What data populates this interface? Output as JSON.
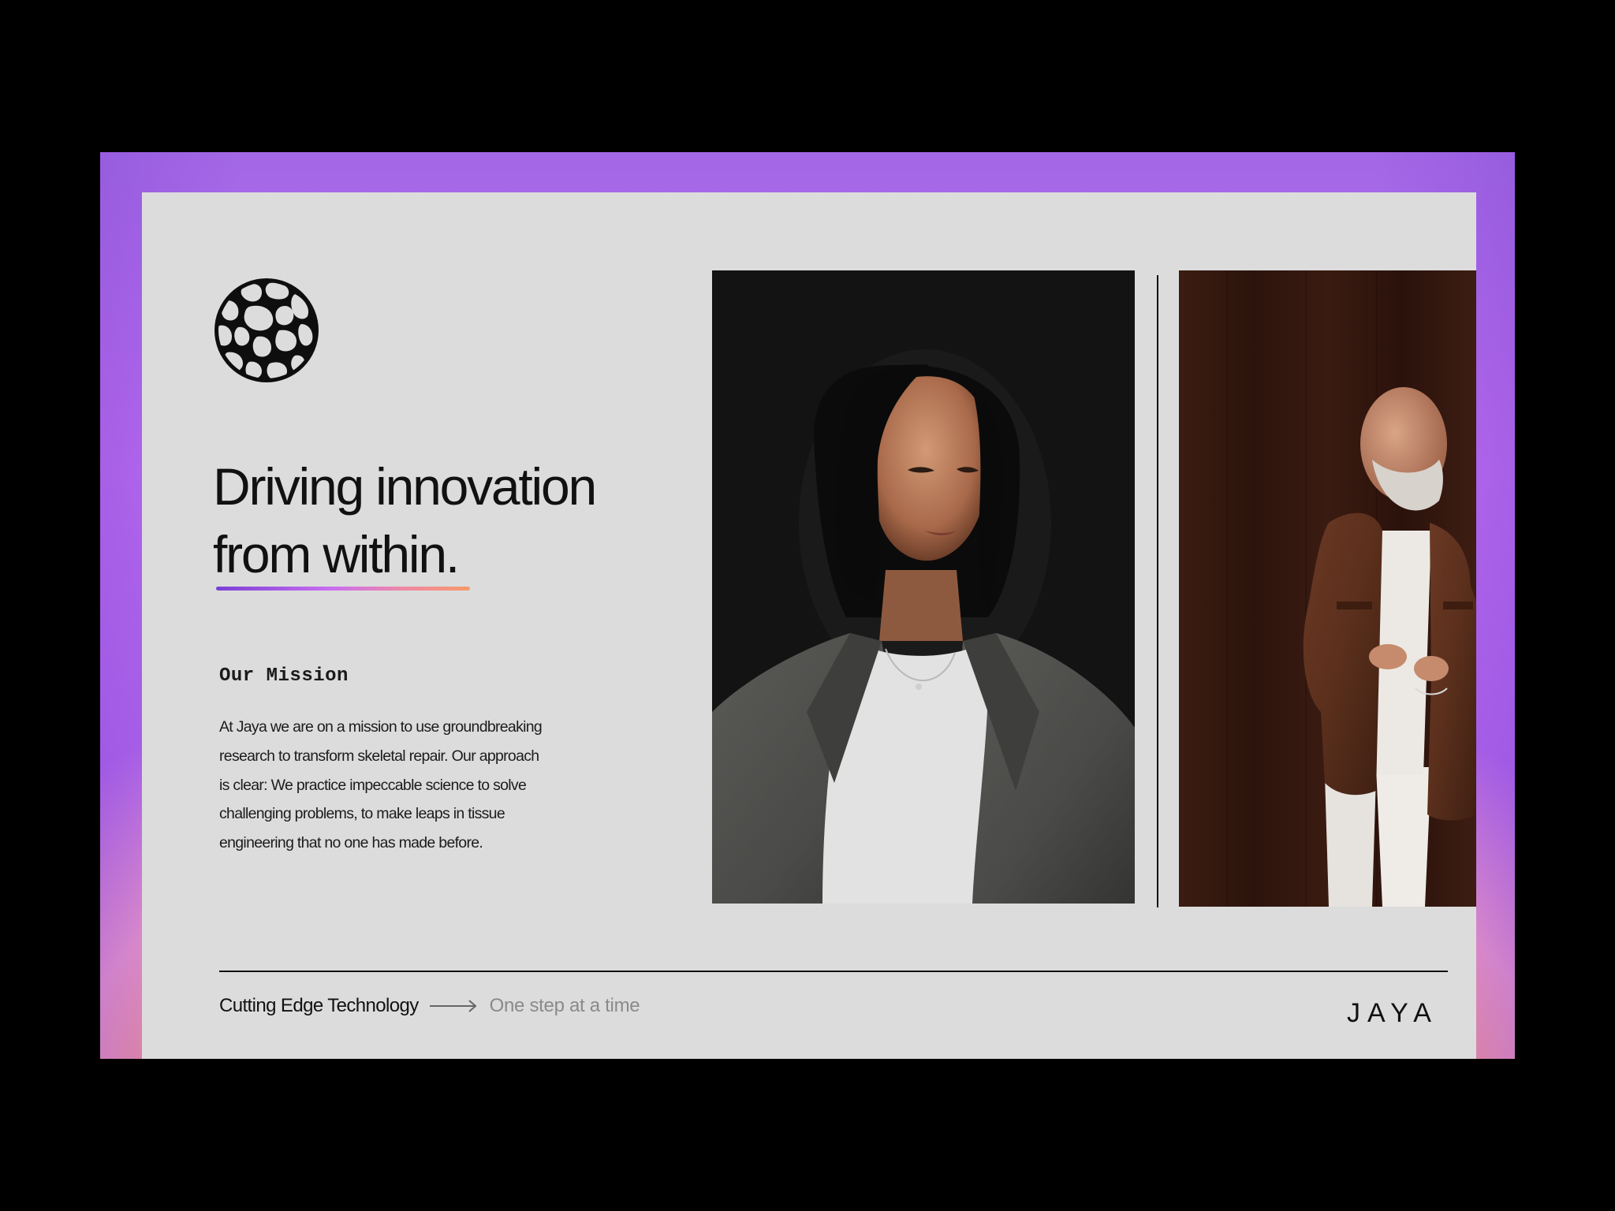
{
  "slide": {
    "headline": {
      "line1": "Driving innovation",
      "line2": "from within."
    },
    "mission": {
      "title": "Our Mission",
      "lines": [
        "At Jaya we are on a mission to use groundbreaking",
        "research to transform skeletal repair. Our approach",
        "is clear: We practice impeccable science to solve",
        "challenging problems, to make leaps in tissue",
        "engineering that no one has made before."
      ]
    },
    "footer": {
      "primary": "Cutting Edge Technology",
      "secondary": "One step at a time",
      "brand": "JAYA"
    },
    "icons": {
      "logo": "cellular-sphere-logo-icon",
      "arrow": "arrow-right-icon"
    },
    "photos": {
      "left": "portrait-woman-photo",
      "right": "portrait-man-photo"
    }
  },
  "colors": {
    "page_background": "#000000",
    "card_background": "#dcdcdc",
    "frame_gradient_top": "#bc6df2",
    "frame_gradient_bottom": "#fa7d92",
    "accent_bar": [
      "#7a3fd6",
      "#c96ef0",
      "#f08aa2",
      "#f59a68"
    ],
    "text_primary": "#111111",
    "text_muted": "#8a8a8a"
  }
}
